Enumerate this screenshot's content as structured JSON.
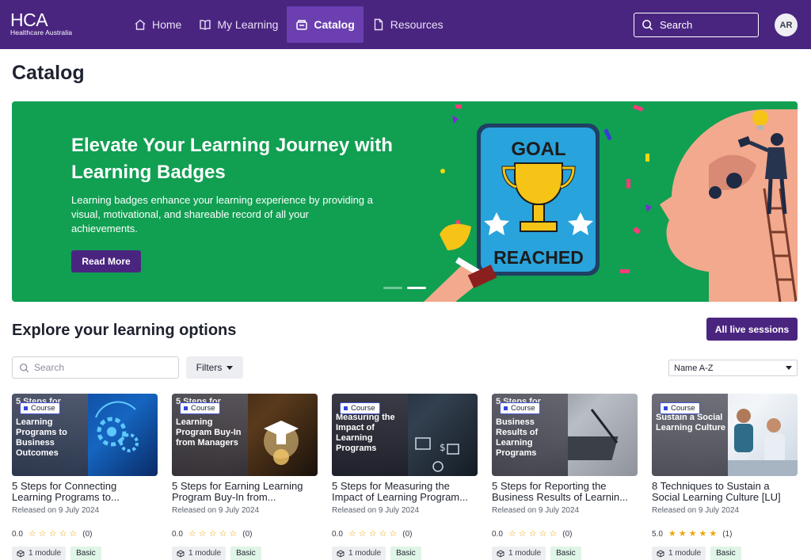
{
  "logo": {
    "main": "HCA",
    "sub": "Healthcare Australia"
  },
  "nav": [
    {
      "label": "Home",
      "icon": "home-icon"
    },
    {
      "label": "My Learning",
      "icon": "book-icon"
    },
    {
      "label": "Catalog",
      "icon": "catalog-icon"
    },
    {
      "label": "Resources",
      "icon": "file-icon"
    }
  ],
  "header": {
    "search_label": "Search",
    "avatar_initials": "AR"
  },
  "page": {
    "title": "Catalog"
  },
  "banner": {
    "title": "Elevate Your Learning Journey with Learning Badges",
    "description": "Learning badges enhance your learning experience by providing a visual, motivational, and shareable record of all your achievements.",
    "button": "Read More",
    "art_top": "GOAL",
    "art_bottom": "REACHED"
  },
  "explore": {
    "title": "Explore your learning options",
    "live_button": "All live sessions",
    "search_placeholder": "Search",
    "filters_label": "Filters",
    "sort_value": "Name A-Z"
  },
  "colors": {
    "brand": "#4a2580",
    "banner": "#119f52",
    "star": "#f0a500"
  },
  "cards": [
    {
      "badge": "Course",
      "thumb_ghost": "5 Steps for",
      "thumb_text": "Learning Programs to Business Outcomes",
      "title_line1": "5 Steps for Connecting",
      "title_line2": "Learning Programs to...",
      "released": "Released on 9 July 2024",
      "rating": "0.0",
      "count": "(0)",
      "stars": 0,
      "modules": "1 module",
      "level": "Basic"
    },
    {
      "badge": "Course",
      "thumb_ghost": "5 Steps for",
      "thumb_text": "Learning Program Buy-In from Managers",
      "title_line1": "5 Steps for Earning Learning",
      "title_line2": "Program Buy-In from...",
      "released": "Released on 9 July 2024",
      "rating": "0.0",
      "count": "(0)",
      "stars": 0,
      "modules": "1 module",
      "level": "Basic"
    },
    {
      "badge": "Course",
      "thumb_ghost": "",
      "thumb_text": "Measuring the Impact of Learning Programs",
      "title_line1": "5 Steps for Measuring the",
      "title_line2": "Impact of Learning Program...",
      "released": "Released on 9 July 2024",
      "rating": "0.0",
      "count": "(0)",
      "stars": 0,
      "modules": "1 module",
      "level": "Basic"
    },
    {
      "badge": "Course",
      "thumb_ghost": "5 Steps for",
      "thumb_text": "Business Results of Learning Programs",
      "title_line1": "5 Steps for Reporting the",
      "title_line2": "Business Results of Learnin...",
      "released": "Released on 9 July 2024",
      "rating": "0.0",
      "count": "(0)",
      "stars": 0,
      "modules": "1 module",
      "level": "Basic"
    },
    {
      "badge": "Course",
      "thumb_ghost": "",
      "thumb_text": "Sustain a Social Learning Culture",
      "title_line1": "8 Techniques to Sustain a",
      "title_line2": "Social Learning Culture [LU]",
      "released": "Released on 9 July 2024",
      "rating": "5.0",
      "count": "(1)",
      "stars": 5,
      "modules": "1 module",
      "level": "Basic"
    }
  ]
}
